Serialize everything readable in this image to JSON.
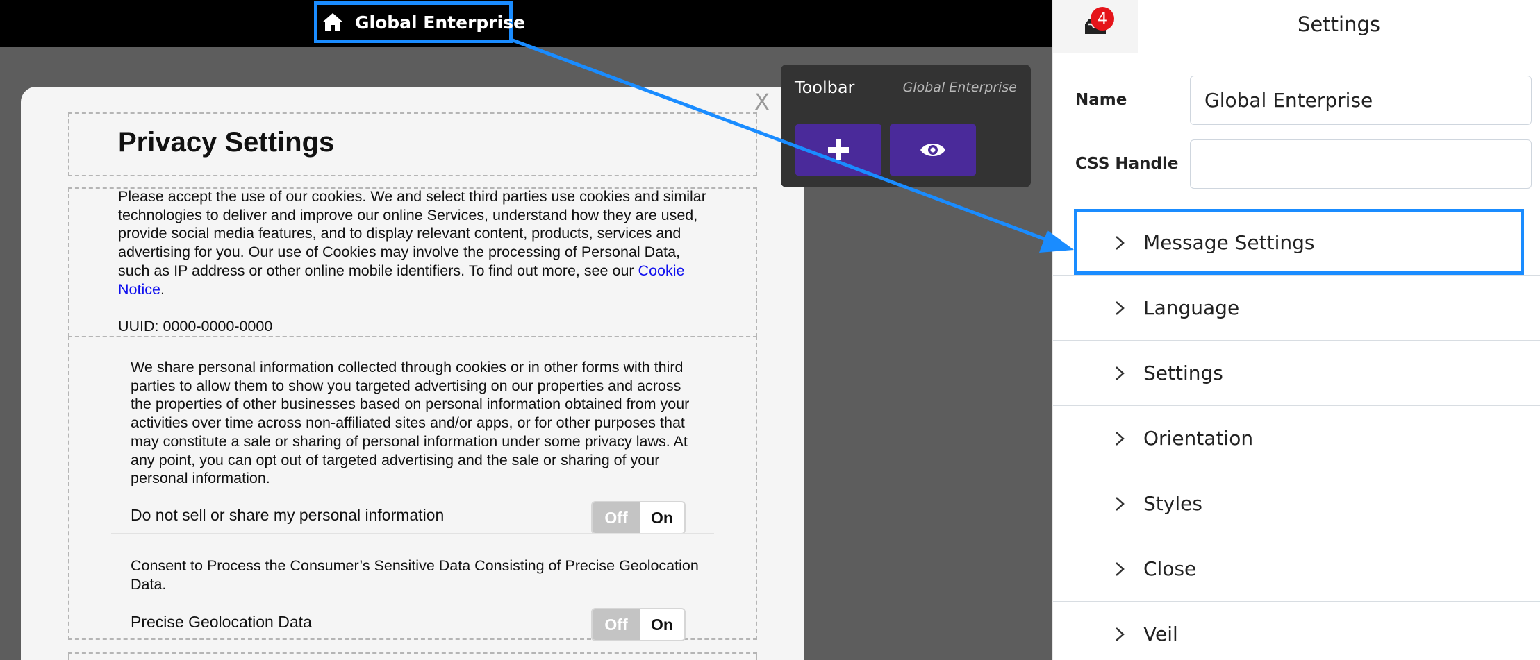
{
  "topbar": {
    "home_label": "Global Enterprise"
  },
  "modal": {
    "close_label": "X",
    "title": "Privacy Settings",
    "intro_text": "Please accept the use of our cookies. We and select third parties use cookies and similar technologies to deliver and improve our online Services, understand how they are used, provide social media features, and to display relevant content, products, services and advertising for you. Our use of Cookies may involve the processing of Personal Data, such as IP address or other online mobile identifiers. To find out more, see our ",
    "cookie_link": "Cookie Notice",
    "intro_end": ".",
    "uuid": "UUID: 0000-0000-0000",
    "share_text": "We share personal information collected through cookies or in other forms with third parties to allow them to show you targeted advertising on our properties and across the properties of other businesses based on personal information obtained from your activities over time across non-affiliated sites and/or apps, or for other purposes that may constitute a sale or sharing of personal information under some privacy laws. At any point, you can opt out of targeted advertising and the sale or sharing of your personal information.",
    "toggle1_label": "Do not sell or share my personal information",
    "consent_text": "Consent to Process the Consumer’s Sensitive Data Consisting of Precise Geolocation Data.",
    "toggle2_label": "Precise Geolocation Data",
    "toggle_off": "Off",
    "toggle_on": "On"
  },
  "toolbar": {
    "title": "Toolbar",
    "subtitle": "Global Enterprise"
  },
  "settings_panel": {
    "badge_count": "4",
    "title": "Settings",
    "name_label": "Name",
    "name_value": "Global Enterprise",
    "css_label": "CSS Handle",
    "css_value": "",
    "sections": [
      {
        "label": "Message Settings"
      },
      {
        "label": "Language"
      },
      {
        "label": "Settings"
      },
      {
        "label": "Orientation"
      },
      {
        "label": "Styles"
      },
      {
        "label": "Close"
      },
      {
        "label": "Veil"
      }
    ]
  },
  "colors": {
    "accent_blue": "#1a8cff",
    "toolbar_button": "#4a2a9a",
    "badge_red": "#e5141a",
    "link_blue": "#1010ee"
  }
}
